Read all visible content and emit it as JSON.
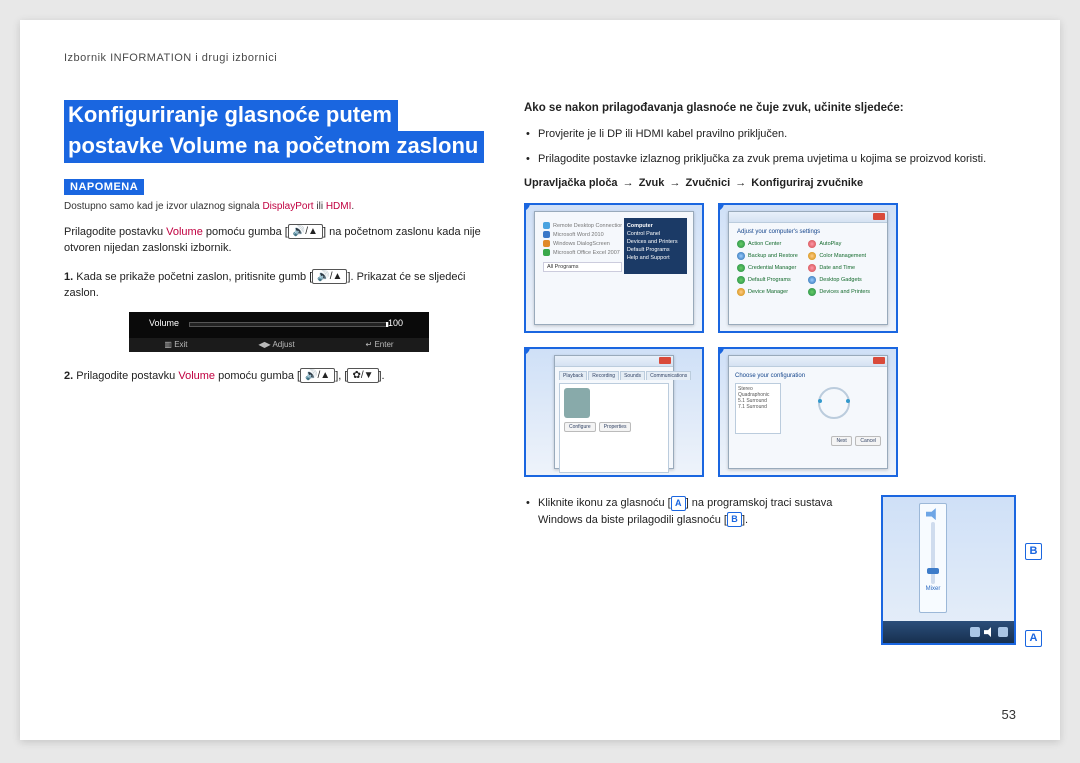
{
  "breadcrumb": "Izbornik INFORMATION i drugi izbornici",
  "title_line1": "Konfiguriranje glasnoće putem",
  "title_line2": "postavke Volume na početnom zaslonu",
  "note_badge": "NAPOMENA",
  "note_text_pre": "Dostupno samo kad je izvor ulaznog signala ",
  "note_text_dp": "DisplayPort",
  "note_text_mid": " ili ",
  "note_text_hdmi": "HDMI",
  "note_text_post": ".",
  "body_pre": "Prilagodite postavku ",
  "body_vol": "Volume",
  "body_post": " pomoću gumba [",
  "body_icon": "🔊/▲",
  "body_after_btn": "] na početnom zaslonu kada nije otvoren nijedan zaslonski izbornik.",
  "steps": {
    "1": {
      "num": "1.",
      "pre": " Kada se prikaže početni zaslon, pritisnite gumb [",
      "btn": "🔊/▲",
      "post": "]. Prikazat će se sljedeći zaslon."
    },
    "2": {
      "num": "2.",
      "pre": " Prilagodite postavku ",
      "vol": "Volume",
      "mid": " pomoću gumba [",
      "btn1": "🔊/▲",
      "sep": "], [",
      "btn2": "✿/▼",
      "post": "]."
    }
  },
  "osd": {
    "label": "Volume",
    "value": "100",
    "exit": "Exit",
    "adjust": "Adjust",
    "enter": "Enter"
  },
  "right_heading": "Ako se nakon prilagođavanja glasnoće ne čuje zvuk, učinite sljedeće:",
  "bullets": {
    "b1": "Provjerite je li DP ili HDMI kabel pravilno priključen.",
    "b2": "Prilagodite postavke izlaznog priključka za zvuk prema uvjetima u kojima se proizvod koristi."
  },
  "path": {
    "p1": "Upravljačka ploča",
    "arrow": "→",
    "p2": "Zvuk",
    "p3": "Zvučnici",
    "p4": "Konfiguriraj zvučnike"
  },
  "thumbs": {
    "t1": {
      "badge": "1"
    },
    "t2": {
      "badge": "2"
    },
    "t3": {
      "badge": "3"
    },
    "t4": {
      "badge": "4"
    }
  },
  "panel1": {
    "r1": "Remote Desktop Connection",
    "r2": "Microsoft Word 2010",
    "r3": "Windows DialogScreen",
    "r4": "Microsoft Office Excel 2007",
    "allprog": "All Programs",
    "sp_head": "Computer",
    "sp1": "Control Panel",
    "sp2": "Devices and Printers",
    "sp3": "Default Programs",
    "sp4": "Help and Support"
  },
  "panel2": {
    "heading": "Adjust your computer's settings",
    "i1": "Action Center",
    "i2": "AutoPlay",
    "i3": "Backup and Restore",
    "i4": "Color Management",
    "i5": "Credential Manager",
    "i6": "Date and Time",
    "i7": "Default Programs",
    "i8": "Desktop Gadgets",
    "i9": "Device Manager",
    "i10": "Devices and Printers"
  },
  "panel3": {
    "tab1": "Playback",
    "tab2": "Recording",
    "tab3": "Sounds",
    "tab4": "Communications",
    "btn_conf": "Configure",
    "btn_prop": "Properties"
  },
  "panel4": {
    "heading": "Choose your configuration",
    "btn_next": "Next",
    "btn_cancel": "Cancel"
  },
  "lower": {
    "pre": "Kliknite ikonu za glasnoću [",
    "A": "A",
    "mid": "] na programskoj traci sustava Windows da biste prilagodili glasnoću [",
    "B": "B",
    "post": "]."
  },
  "tray": {
    "mixer": "Mixer",
    "labelA": "A",
    "labelB": "B"
  },
  "page_number": "53"
}
